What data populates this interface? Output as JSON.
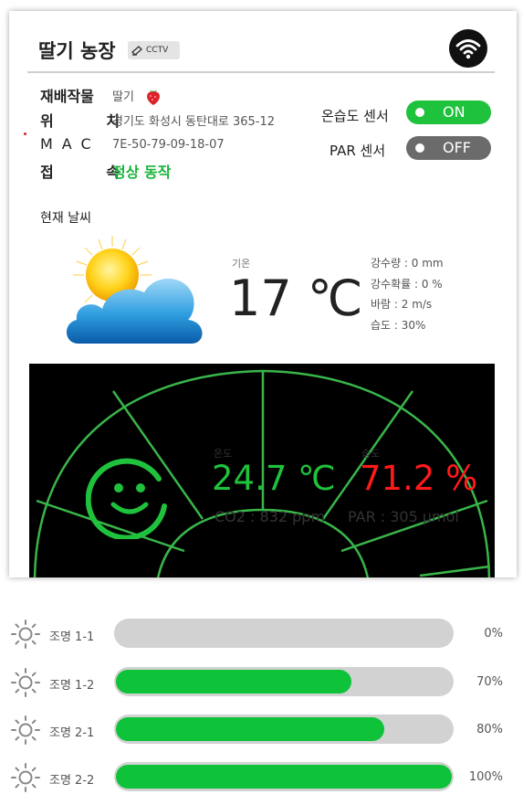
{
  "header": {
    "title": "딸기 농장",
    "cctv_label": "CCTV"
  },
  "info": {
    "crop_label": "재배작물",
    "crop_value": "딸기",
    "location_label": "위 치",
    "location_value": "경기도 화성시 동탄대로 365-12",
    "mac_label": "MAC",
    "mac_value": "7E-50-79-09-18-07",
    "connection_label": "접 속",
    "connection_value": "정상 동작"
  },
  "sensors": [
    {
      "label": "온습도 센서",
      "state": "ON"
    },
    {
      "label": "PAR 센서",
      "state": "OFF"
    }
  ],
  "weather": {
    "title": "현재 날씨",
    "temp_label": "기온",
    "temp_value": "17 ℃",
    "rain": "강수량 : 0 mm",
    "rain_prob": "강수확률 : 0 %",
    "wind": "바람 : 2 m/s",
    "humidity": "습도 : 30%"
  },
  "monitor": {
    "temp_label": "온도",
    "temp_value": "24.7 ℃",
    "humidity_label": "습도",
    "humidity_value": "71.2 %",
    "co2": "CO2 : 832 ppm",
    "par": "PAR : 305 μmol"
  },
  "lights": [
    {
      "name": "조명 1-1",
      "percent": "0%",
      "level": 0
    },
    {
      "name": "조명 1-2",
      "percent": "70%",
      "level": 0.7
    },
    {
      "name": "조명 2-1",
      "percent": "80%",
      "level": 0.8
    },
    {
      "name": "조명 2-2",
      "percent": "100%",
      "level": 1.0
    }
  ],
  "colors": {
    "accent_green": "#1fc23d",
    "alert_red": "#ff1a1a",
    "off_gray": "#6b6b6b"
  }
}
